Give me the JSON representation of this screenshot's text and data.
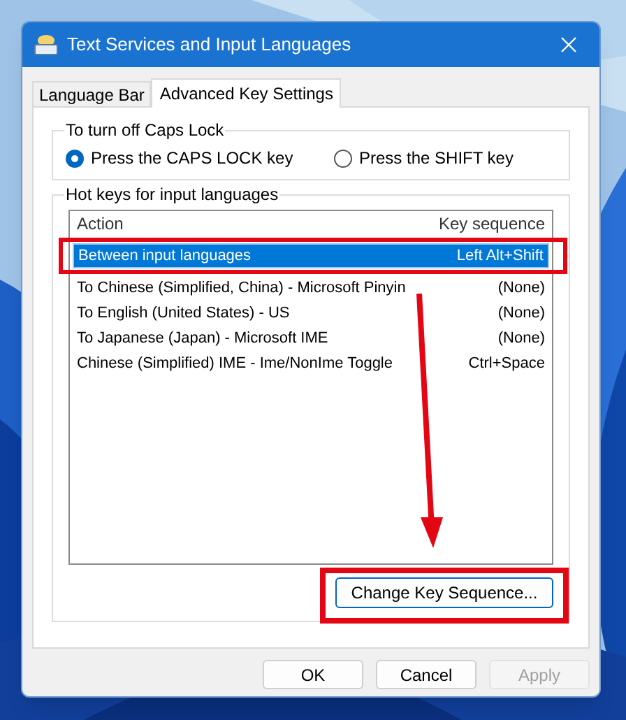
{
  "window": {
    "title": "Text Services and Input Languages"
  },
  "tabs": [
    {
      "label": "Language Bar",
      "selected": false
    },
    {
      "label": "Advanced Key Settings",
      "selected": true
    }
  ],
  "caps_lock": {
    "title": "To turn off Caps Lock",
    "options": [
      {
        "label": "Press the CAPS LOCK key",
        "selected": true
      },
      {
        "label": "Press the SHIFT key",
        "selected": false
      }
    ]
  },
  "hot_keys": {
    "title": "Hot keys for input languages",
    "columns": [
      "Action",
      "Key sequence"
    ],
    "rows": [
      {
        "action": "Between input languages",
        "key_sequence": "Left Alt+Shift",
        "selected": true
      },
      {
        "action": "To Chinese (Simplified, China) - Microsoft Pinyin",
        "key_sequence": "(None)",
        "selected": false
      },
      {
        "action": "To English (United States) - US",
        "key_sequence": "(None)",
        "selected": false
      },
      {
        "action": "To Japanese (Japan) - Microsoft IME",
        "key_sequence": "(None)",
        "selected": false
      },
      {
        "action": "Chinese (Simplified) IME - Ime/NonIme Toggle",
        "key_sequence": "Ctrl+Space",
        "selected": false
      }
    ],
    "change_button": "Change Key Sequence..."
  },
  "buttons": [
    {
      "label": "OK",
      "disabled": false
    },
    {
      "label": "Cancel",
      "disabled": false
    },
    {
      "label": "Apply",
      "disabled": true
    }
  ]
}
